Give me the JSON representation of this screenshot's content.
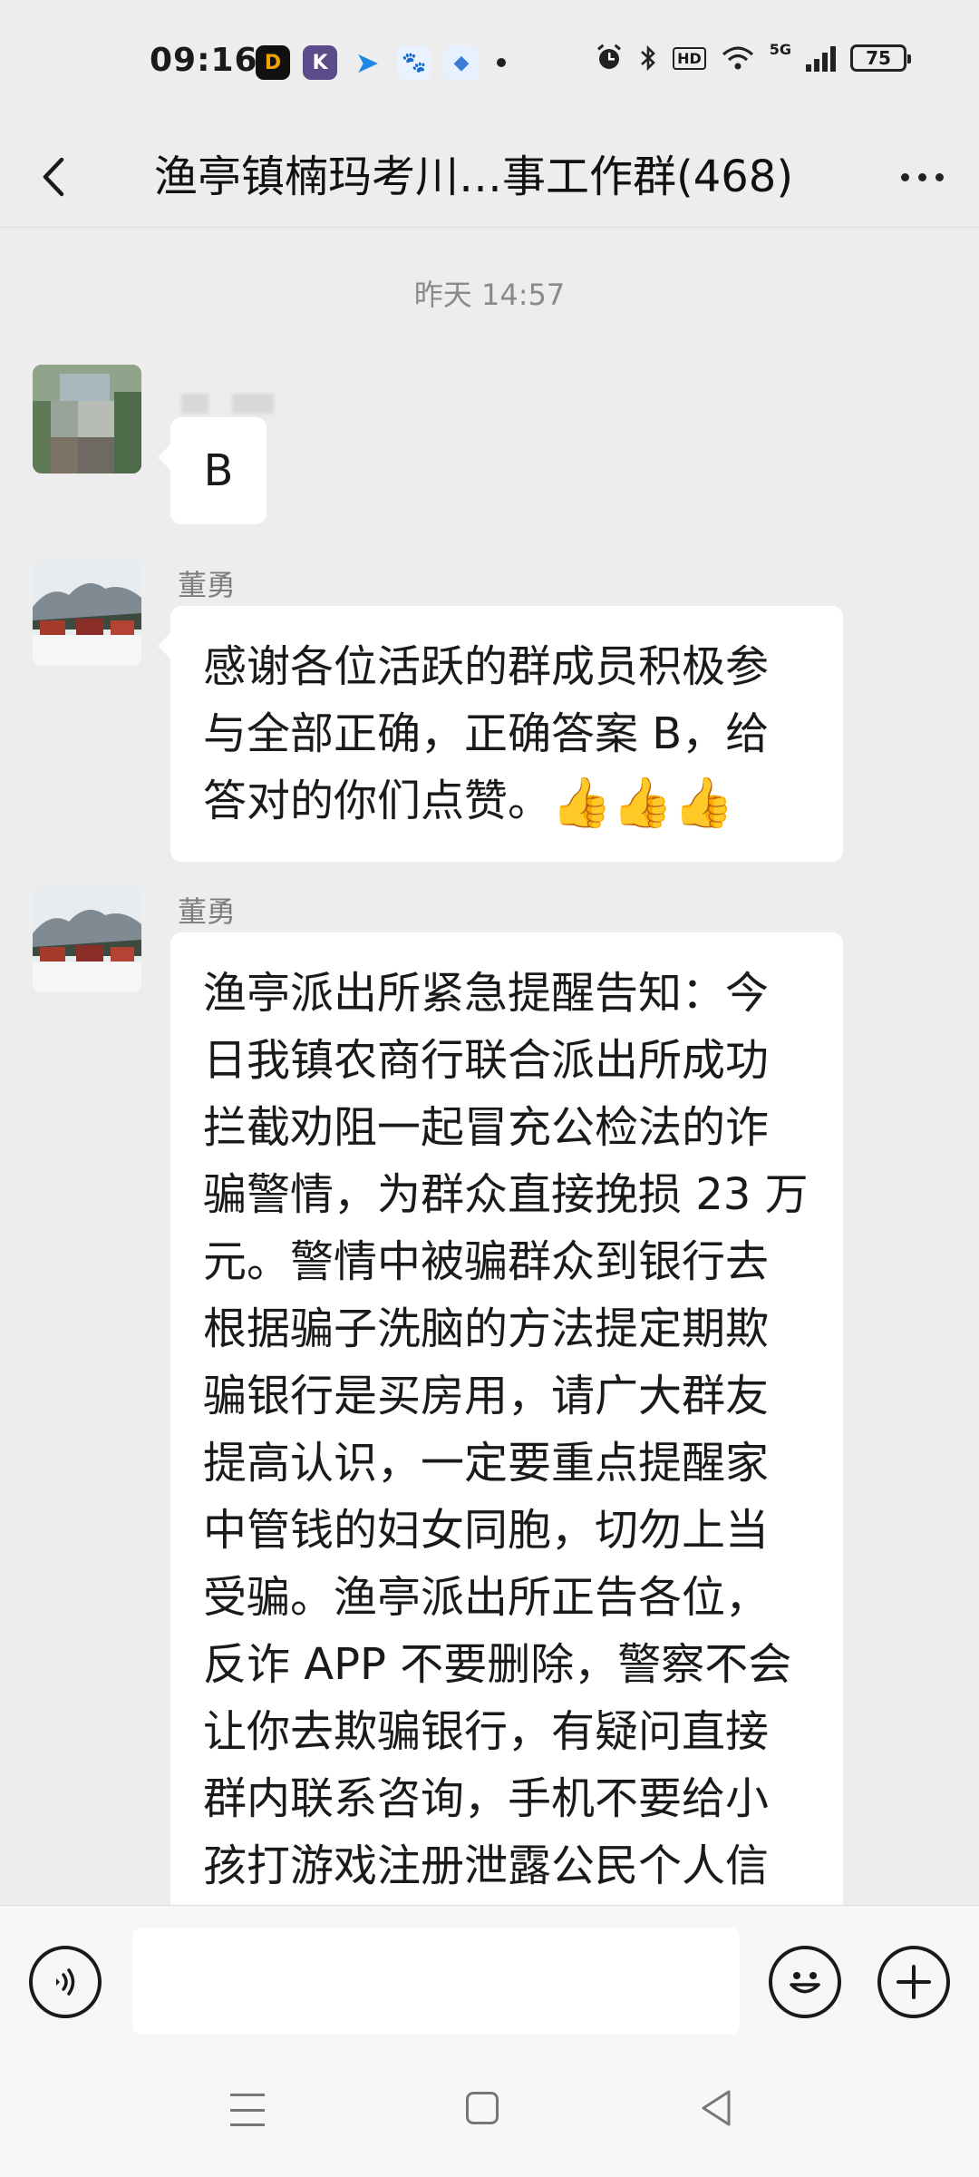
{
  "status_bar": {
    "time": "09:16",
    "app_icons": [
      "D",
      "K",
      "➤",
      "🐾",
      "◆"
    ],
    "hd": "HD",
    "network": "5G",
    "battery": "75"
  },
  "header": {
    "title": "渔亭镇楠玛考川…事工作群(468)"
  },
  "chat": {
    "timestamp": "昨天 14:57",
    "messages": [
      {
        "sender": "",
        "text": "B"
      },
      {
        "sender": "董勇",
        "text": "感谢各位活跃的群成员积极参与全部正确，正确答案 B，给答对的你们点赞。",
        "emoji": "👍👍👍"
      },
      {
        "sender": "董勇",
        "text": "渔亭派出所紧急提醒告知：今日我镇农商行联合派出所成功拦截劝阻一起冒充公检法的诈骗警情，为群众直接挽损 23 万元。警情中被骗群众到银行去根据骗子洗脑的方法提定期欺骗银行是买房用，请广大群友提高认识，一定要重点提醒家中管钱的妇女同胞，切勿上当受骗。渔亭派出所正告各位，反诈 APP 不要删除，警察不会让你去欺骗银行，有疑问直接群内联系咨询，手机不要给小孩打游戏注册泄露公民个人信"
      }
    ]
  },
  "input_bar": {
    "value": ""
  }
}
